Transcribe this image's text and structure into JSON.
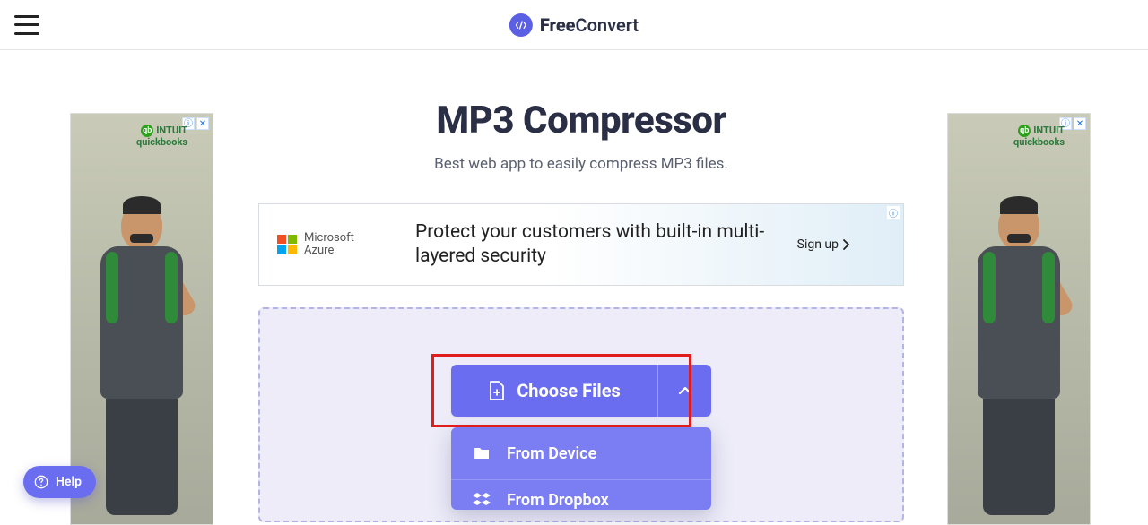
{
  "brand": {
    "bold": "Free",
    "light": "Convert"
  },
  "page": {
    "title": "MP3 Compressor",
    "subtitle": "Best web app to easily compress MP3 files."
  },
  "banner_ad": {
    "provider_line1": "Microsoft",
    "provider_line2": "Azure",
    "message": "Protect your customers with built-in multi-layered security",
    "cta": "Sign up"
  },
  "side_ad": {
    "brand_top": "INTUIT",
    "brand_bottom": "quickbooks"
  },
  "upload": {
    "choose_label": "Choose Files",
    "options": [
      {
        "key": "device",
        "label": "From Device"
      },
      {
        "key": "dropbox",
        "label": "From Dropbox"
      }
    ]
  },
  "help": {
    "label": "Help"
  }
}
